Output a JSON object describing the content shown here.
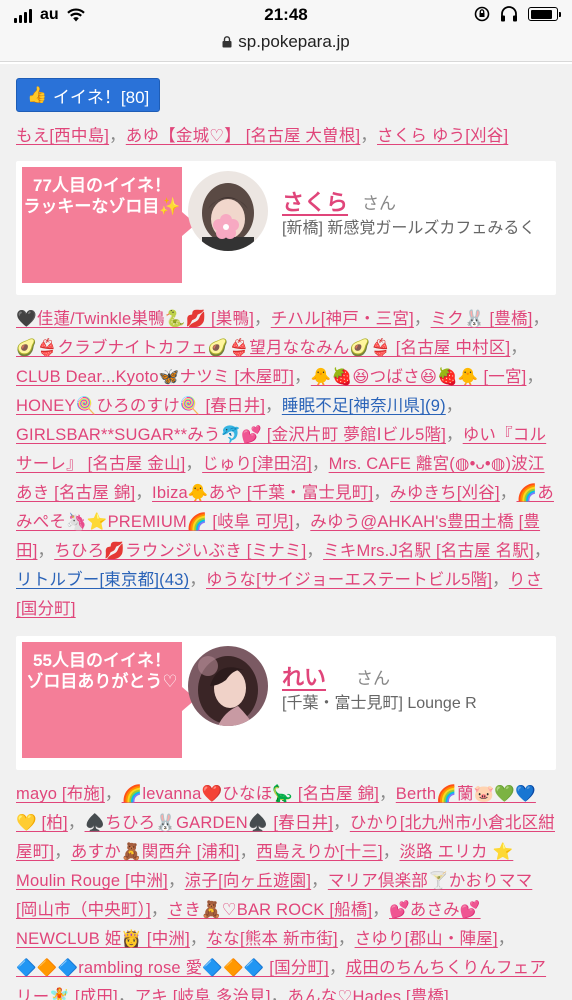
{
  "status_bar": {
    "carrier": "au",
    "time": "21:48"
  },
  "browser": {
    "url": "sp.pokepara.jp"
  },
  "like_button": {
    "label": "イイネ！[80]"
  },
  "top_names": [
    {
      "text": "もえ[西中島]"
    },
    {
      "text": "あゆ【金城♡】 [名古屋 大曽根]"
    },
    {
      "text": "さくら ゆう[刈谷]"
    }
  ],
  "card1": {
    "milestone": "77人目のイイネ！\nラッキーなゾロ目✨",
    "name": "さくら",
    "suffix": "さん",
    "shop": "[新橋] 新感覚ガールズカフェみるく"
  },
  "list1": [
    {
      "text": "🖤佳蓮/Twinkle巣鴨🐍💋 [巣鴨]"
    },
    {
      "text": "チハル[神戸・三宮]"
    },
    {
      "text": "ミク🐰 [豊橋]"
    },
    {
      "text": "🥑👙クラブナイトカフェ🥑👙望月ななみん🥑👙 [名古屋 中村区]"
    },
    {
      "text": "CLUB Dear...Kyoto🦋ナツミ [木屋町]"
    },
    {
      "text": "🐥🍓😆つばさ😆🍓🐥 [一宮]"
    },
    {
      "text": "HONEY🍭ひろのすけ🍭 [春日井]"
    },
    {
      "text": "睡眠不足[神奈川県](9)",
      "blue": true
    },
    {
      "text": "GIRLSBAR**SUGAR**みう🐬💕 [金沢片町 夢館Ⅰビル5階]"
    },
    {
      "text": "ゆい『コルサーレ』 [名古屋 金山]"
    },
    {
      "text": "じゅり[津田沼]"
    },
    {
      "text": "Mrs. CAFE 離宮(◍•ᴗ•◍)波江あき [名古屋 錦]"
    },
    {
      "text": "Ibiza🐥あや [千葉・富士見町]"
    },
    {
      "text": "みゆきち[刈谷]"
    },
    {
      "text": "🌈あみぺそ🦄⭐PREMIUM🌈 [岐阜 可児]"
    },
    {
      "text": "みゆう@AHKAH's豊田土橋 [豊田]"
    },
    {
      "text": "ちひろ💋ラウンジいぶき [ミナミ]"
    },
    {
      "text": "ミキMrs.J名駅 [名古屋 名駅]"
    },
    {
      "text": "リトルブー[東京都](43)",
      "blue": true
    },
    {
      "text": "ゆうな[サイジョーエステートビル5階]"
    },
    {
      "text": "りさ [国分町]"
    }
  ],
  "card2": {
    "milestone": "55人目のイイネ！\nゾロ目ありがとう♡",
    "name": "れい",
    "suffix": "さん",
    "shop": "[千葉・富士見町] Lounge R"
  },
  "list2": [
    {
      "text": "mayo [布施]"
    },
    {
      "text": "🌈levanna❤️ひなほ🦕 [名古屋 錦]"
    },
    {
      "text": "Berth🌈蘭🐷💚💙💛 [柏]"
    },
    {
      "text": "♠️ちひろ🐰GARDEN♠️ [春日井]"
    },
    {
      "text": "ひかり[北九州市小倉北区紺屋町]"
    },
    {
      "text": "あすか🧸関西弁 [浦和]"
    },
    {
      "text": "西島えりか[十三]"
    },
    {
      "text": "淡路 エリカ ⭐ Moulin Rouge [中洲]"
    },
    {
      "text": "涼子[向ヶ丘遊園]"
    },
    {
      "text": "マリア倶楽部🍸かおりママ [岡山市（中央町）]"
    },
    {
      "text": "さき🧸♡BAR ROCK [船橋]"
    },
    {
      "text": "💕あさみ💕NEWCLUB 姫👸 [中洲]"
    },
    {
      "text": "なな[熊本 新市街]"
    },
    {
      "text": "さゆり[郡山・陣屋]"
    },
    {
      "text": "🔷🔶🔷rambling rose 愛🔷🔶🔷 [国分町]"
    },
    {
      "text": "成田のちんちくりんフェアリー🧚 [成田]"
    },
    {
      "text": "アキ [岐阜 多治見]"
    },
    {
      "text": "あんな♡Hades [豊橋]"
    }
  ]
}
